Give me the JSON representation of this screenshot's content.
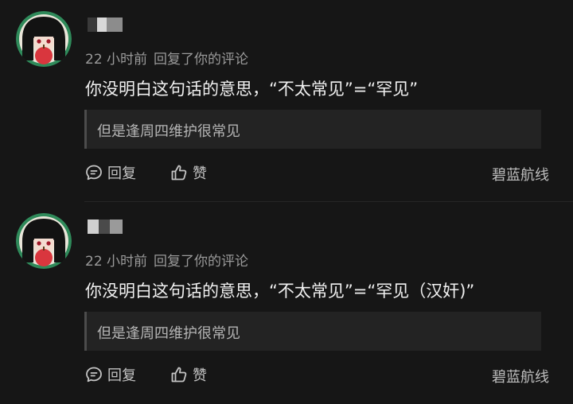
{
  "comments": [
    {
      "time": "22 小时前",
      "action": "回复了你的评论",
      "text": "你没明白这句话的意思，“不太常见”=“罕见”",
      "quote": "但是逢周四维护很常见",
      "reply_label": "回复",
      "like_label": "赞",
      "source": "碧蓝航线"
    },
    {
      "time": "22 小时前",
      "action": "回复了你的评论",
      "text": "你没明白这句话的意思，“不太常见”=“罕见（汉奸)”",
      "quote": "但是逢周四维护很常见",
      "reply_label": "回复",
      "like_label": "赞",
      "source": "碧蓝航线"
    }
  ],
  "colors": {
    "background": "#161616",
    "avatar_ring": "#2f8a5a",
    "apple": "#d9363e"
  },
  "icons": {
    "reply": "chat-bubble-icon",
    "like": "thumbs-up-icon"
  }
}
